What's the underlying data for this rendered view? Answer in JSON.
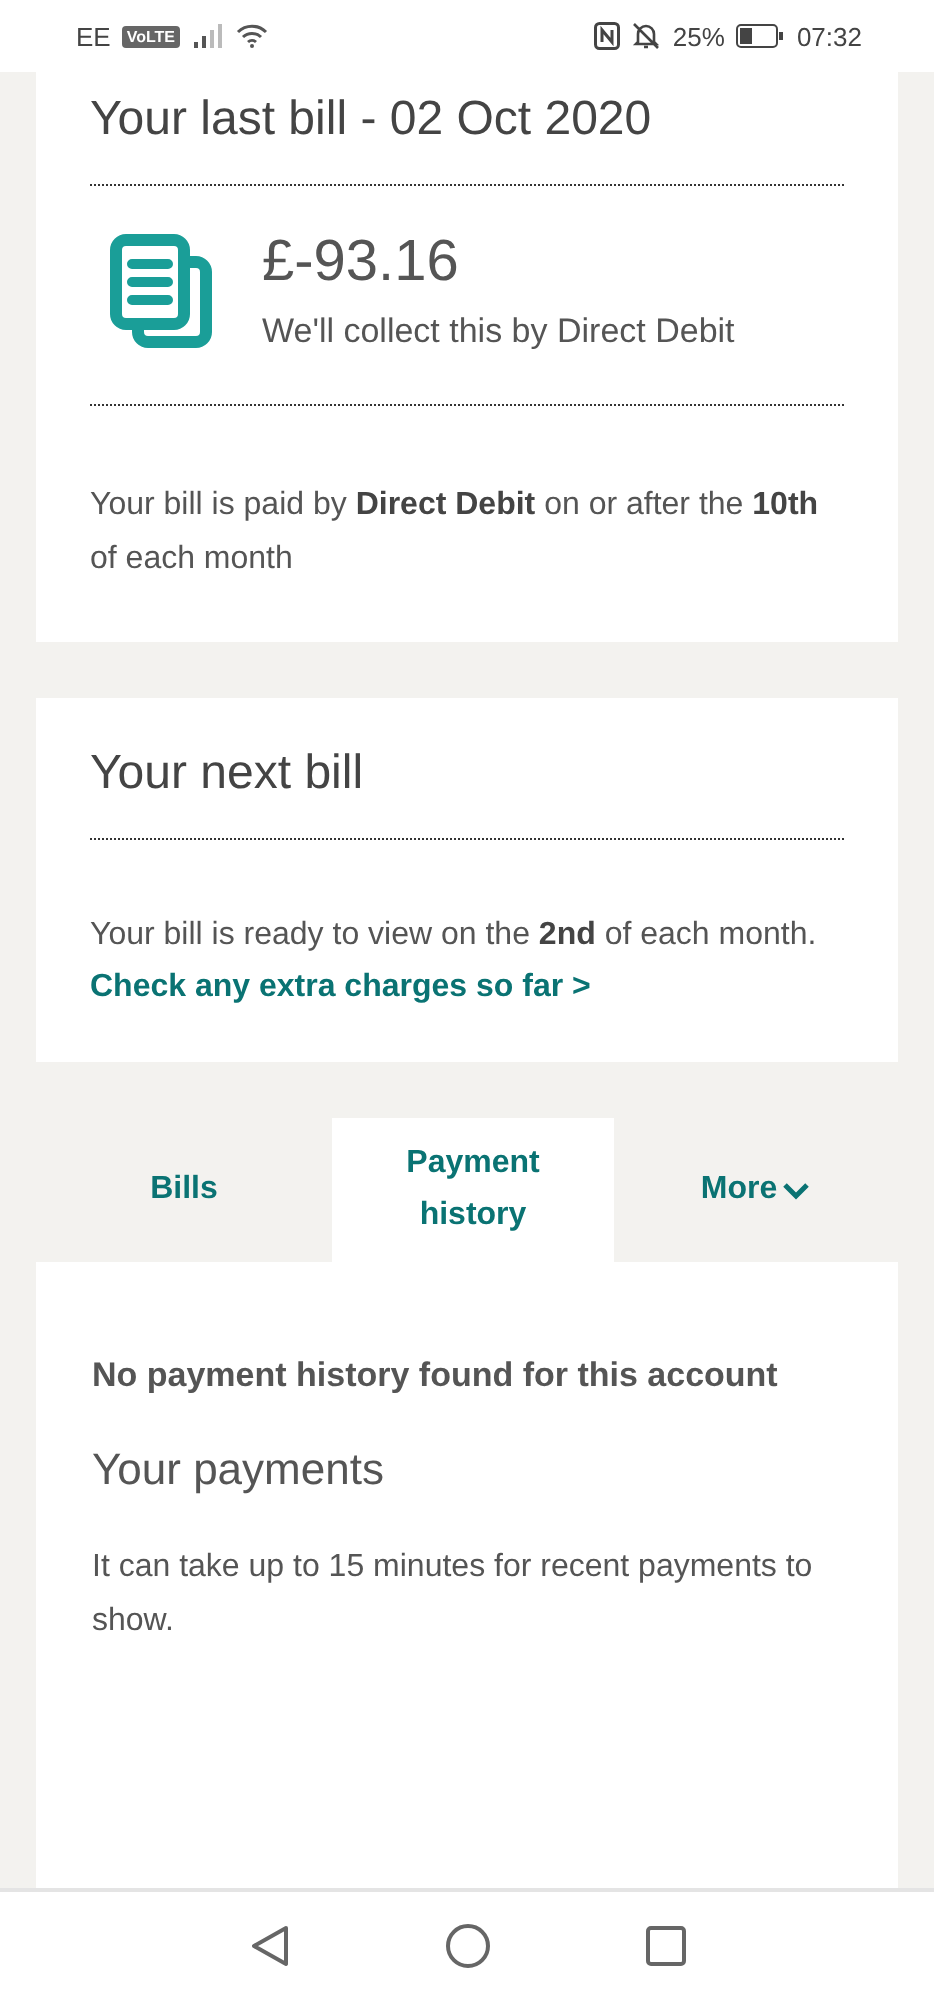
{
  "status_bar": {
    "carrier": "EE",
    "volte": "VoLTE",
    "battery": "25%",
    "time": "07:32"
  },
  "last_bill": {
    "title": "Your last bill - 02 Oct 2020",
    "amount": "£-93.16",
    "note": "We'll collect this by Direct Debit",
    "info": "Your bill is paid by **Direct Debit** on or after the **10th** of each month"
  },
  "next_bill": {
    "title": "Your next bill",
    "info": "Your bill is ready to view on the **2nd** of each month.",
    "link": "Check any extra charges so far >"
  },
  "tabs": [
    {
      "label": "Bills",
      "selected": false,
      "kind": "plain"
    },
    {
      "label": "Payment history",
      "selected": true,
      "kind": "plain"
    },
    {
      "label": "More",
      "selected": false,
      "kind": "dropdown"
    }
  ],
  "payment_history": {
    "empty_message": "No payment history found for this account",
    "heading": "Your payments",
    "info": "It can take up to 15 minutes for recent payments to show."
  }
}
